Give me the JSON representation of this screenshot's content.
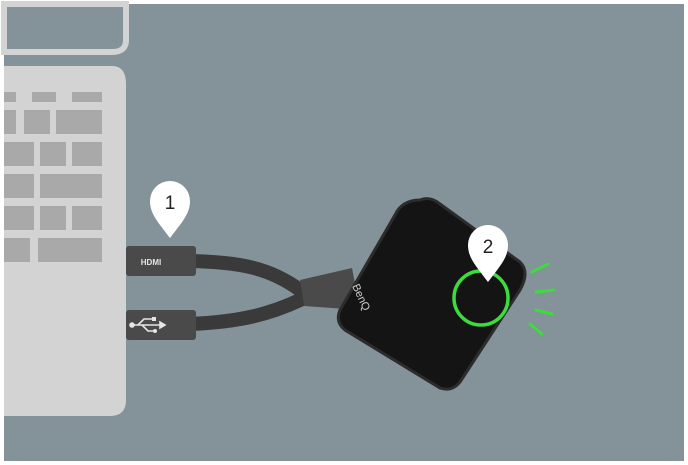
{
  "colors": {
    "background": "#839399",
    "laptop_body": "#d3d3d3",
    "laptop_outline": "#bdbdbd",
    "keys": "#a9a9a9",
    "cable": "#3a3a3a",
    "plug": "#4a4a4a",
    "device_body": "#141414",
    "device_edge": "#2c2c2c",
    "button_ring": "#3ddc3d",
    "glow": "#3ddc3d",
    "pin": "#ffffff"
  },
  "markers": [
    {
      "number": "1"
    },
    {
      "number": "2"
    }
  ],
  "ports": {
    "hdmi_label": "HDMI",
    "usb_icon": "usb-icon"
  },
  "device": {
    "brand": "BenQ"
  }
}
